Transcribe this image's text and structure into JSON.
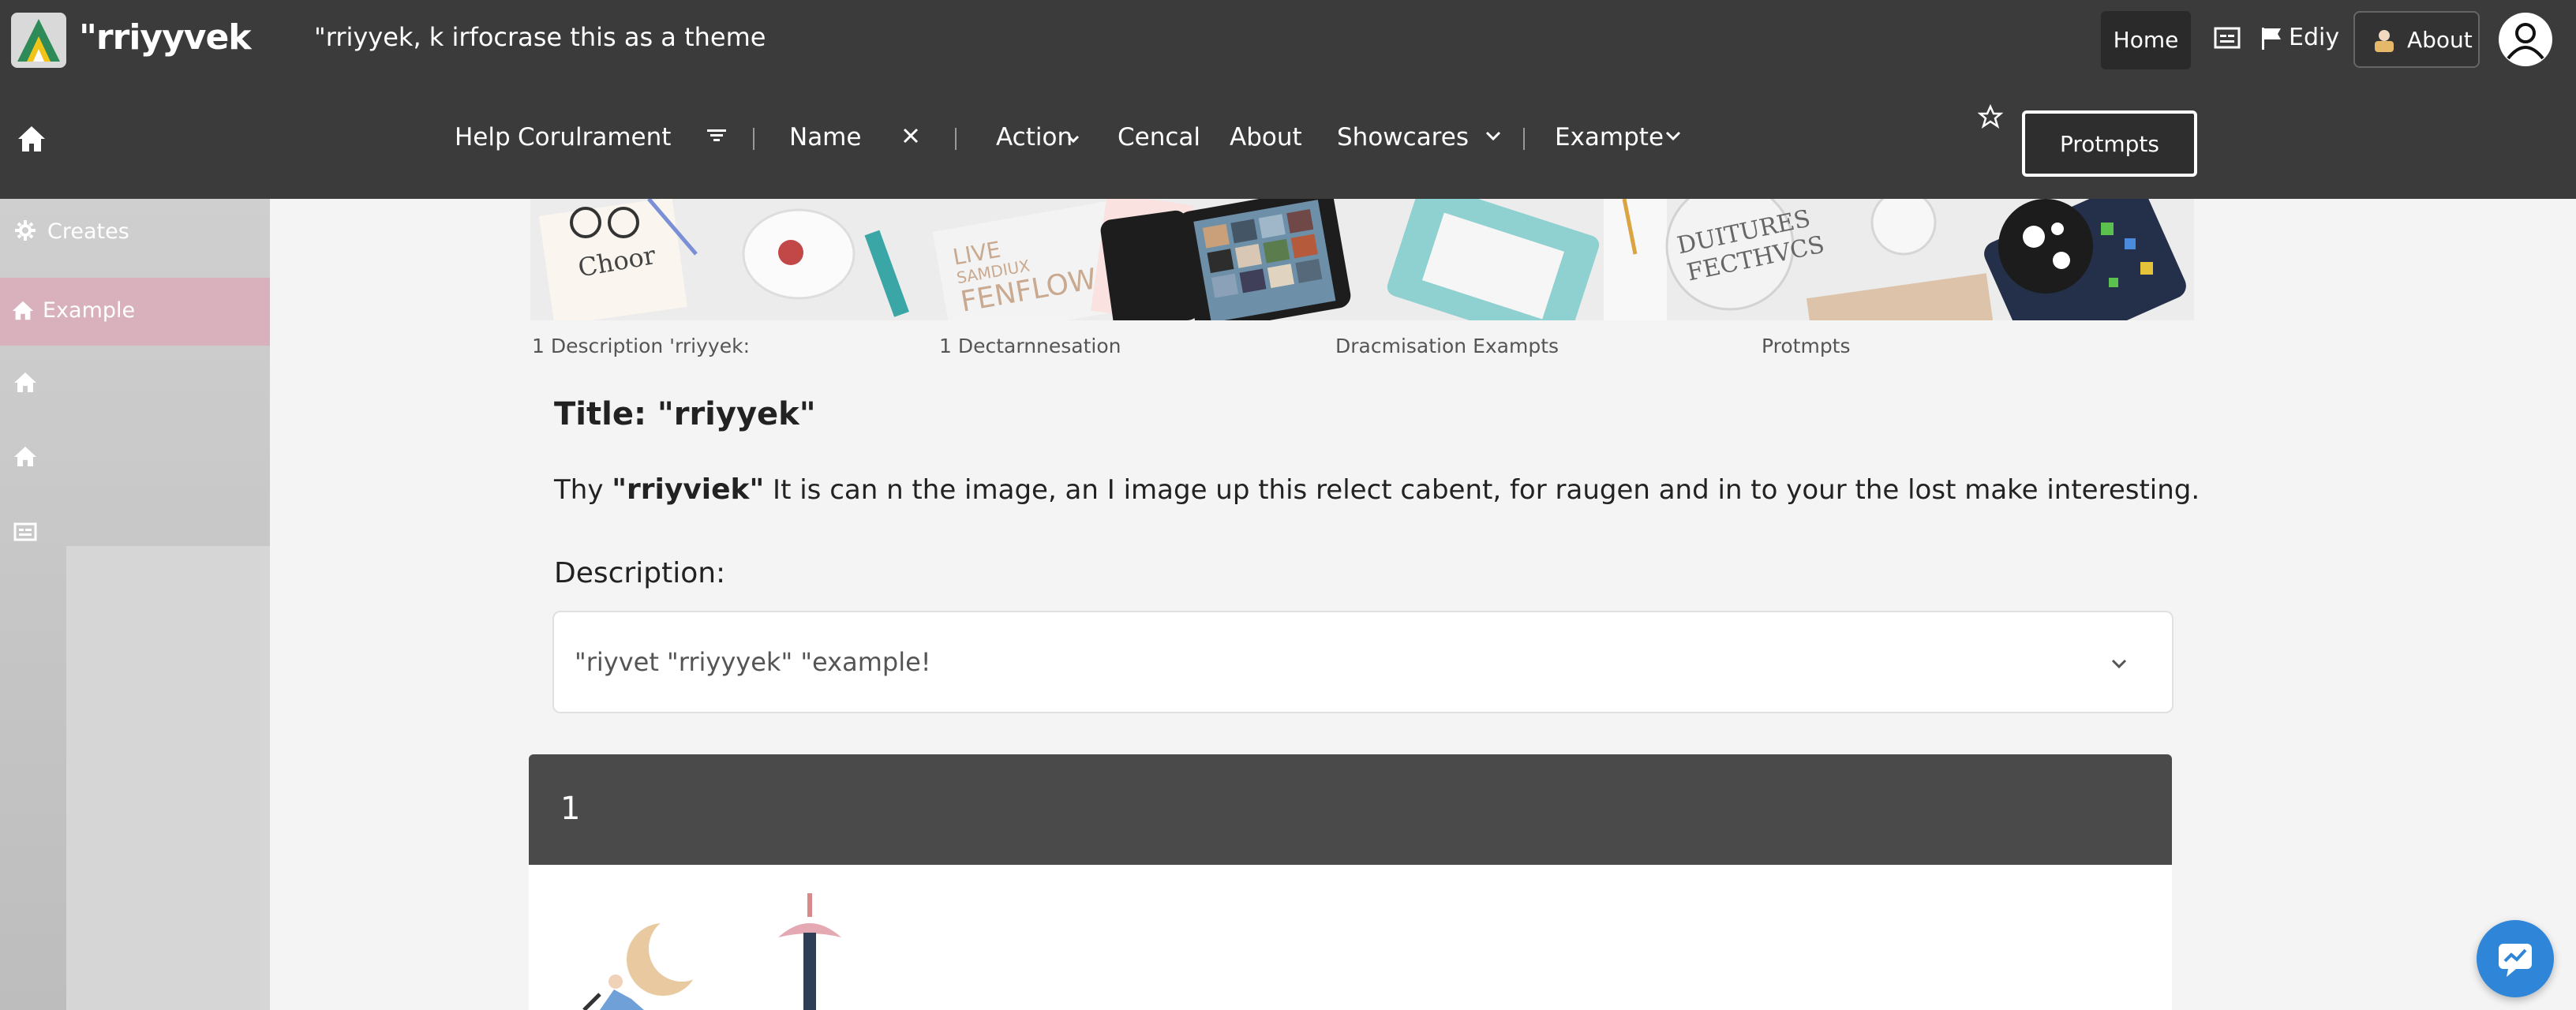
{
  "header": {
    "brand": "\"rriyyvek",
    "window_title": "\"rriyyek, k irfocrase this as a theme",
    "home_label": "Home",
    "edit_label": "Ediy",
    "about_label": "About"
  },
  "nav": {
    "items": [
      "Help",
      "Corulrament",
      "Name",
      "Action",
      "Cencal",
      "About",
      "Showcares",
      "Exampte"
    ],
    "prompts_button": "Protmpts"
  },
  "sidebar": {
    "items": [
      {
        "label": "Creates",
        "icon": "gear-icon"
      },
      {
        "label": "Example",
        "icon": "home-icon"
      }
    ],
    "extra_icons": [
      "home-icon",
      "home-icon",
      "list-icon"
    ]
  },
  "hero": {
    "printed_text": [
      "Choor",
      "LIVE",
      "SAMDIUX",
      "FENFLOW",
      "DUITURES",
      "FECTHVCS"
    ]
  },
  "meta": [
    "1 Description 'rriyyek:",
    "1 Dectarnnesation",
    "Dracmisation Exampts",
    "Protmpts"
  ],
  "content": {
    "title": "Title: \"rriyyek\"",
    "lead_prefix": "Thy ",
    "lead_bold": "\"rriyviek\"",
    "lead_rest": " It is can n the image, an I image up this relect cabent, for raugen and in to your the lost make interesting.",
    "description_label": "Description:",
    "description_value": "\"riyvet \"rriyyyek\" \"example!"
  },
  "panel": {
    "number": "1"
  },
  "colors": {
    "header_bg": "#3b3b3b",
    "active_sidebar": "#d9b1bd",
    "fab": "#2f86d8"
  }
}
